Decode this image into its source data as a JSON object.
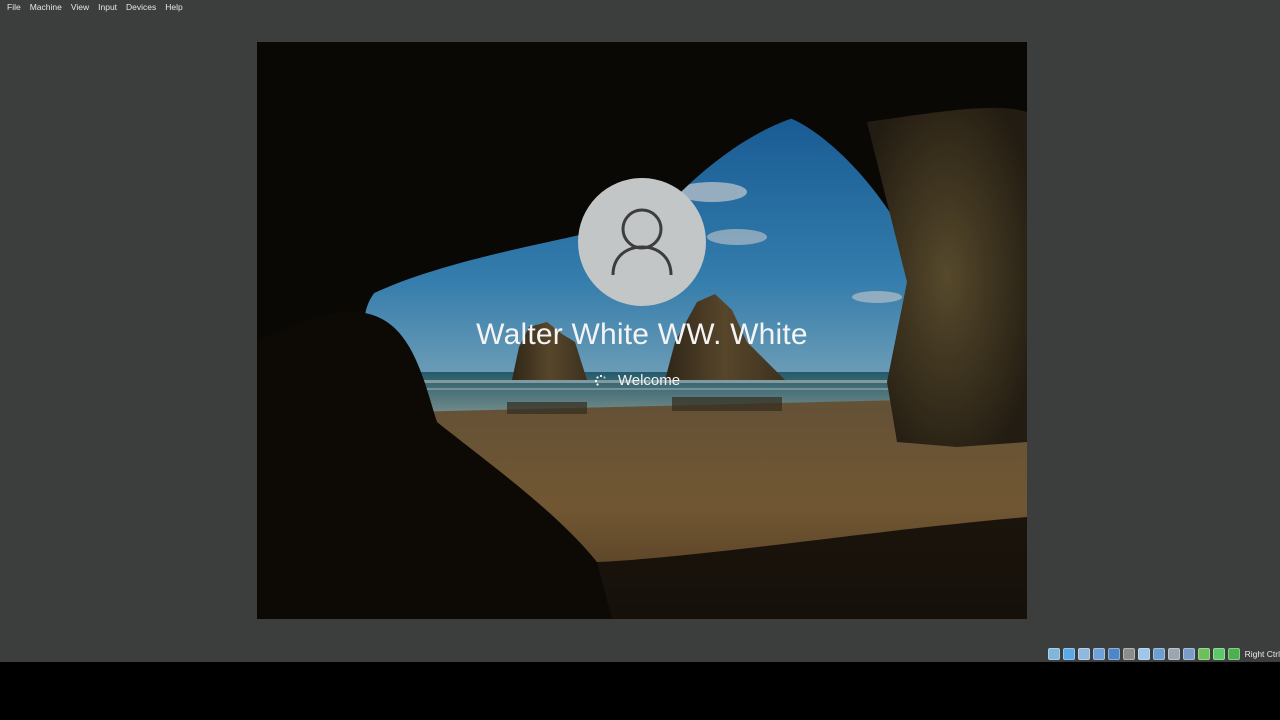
{
  "menu": {
    "items": [
      {
        "label": "File"
      },
      {
        "label": "Machine"
      },
      {
        "label": "View"
      },
      {
        "label": "Input"
      },
      {
        "label": "Devices"
      },
      {
        "label": "Help"
      }
    ]
  },
  "login": {
    "username": "Walter White WW. White",
    "status": "Welcome",
    "avatar_icon": "user-icon",
    "spinner_icon": "spinner-icon"
  },
  "statusbar": {
    "host_key_label": "Right Ctrl",
    "indicators": [
      {
        "icon": "hard-disk-icon",
        "color": "#7fb6d9"
      },
      {
        "icon": "optical-drive-icon",
        "color": "#5aa9e6"
      },
      {
        "icon": "audio-icon",
        "color": "#8fb8de"
      },
      {
        "icon": "network-icon",
        "color": "#6fa0d8"
      },
      {
        "icon": "usb-icon",
        "color": "#4f86c6"
      },
      {
        "icon": "shared-folders-icon",
        "color": "#8c8c8c"
      },
      {
        "icon": "display-icon",
        "color": "#9fc5e8"
      },
      {
        "icon": "video-capture-icon",
        "color": "#6e9fd0"
      },
      {
        "icon": "recording-icon",
        "color": "#9aa6b0"
      },
      {
        "icon": "cpu-icon",
        "color": "#7a9cc6"
      },
      {
        "icon": "guest-additions-icon",
        "color": "#6cbf5a"
      },
      {
        "icon": "mouse-integration-icon",
        "color": "#5bc96b"
      },
      {
        "icon": "keyboard-icon",
        "color": "#4caf50"
      }
    ]
  },
  "colors": {
    "host_background": "#3b3e3d",
    "sky": "#2f86c9",
    "sand": "#8a6a3e",
    "cave": "#0d0a07"
  }
}
